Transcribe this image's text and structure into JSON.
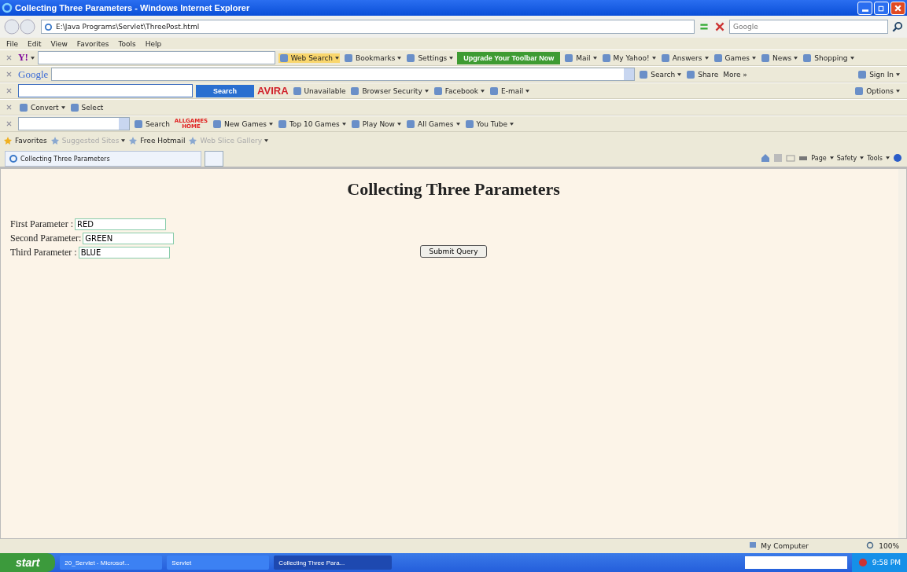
{
  "window": {
    "title": "Collecting Three Parameters - Windows Internet Explorer"
  },
  "address": {
    "value": "E:\\Java Programs\\Servlet\\ThreePost.html",
    "search_placeholder": "Google"
  },
  "menu": [
    "File",
    "Edit",
    "View",
    "Favorites",
    "Tools",
    "Help"
  ],
  "toolbars": [
    {
      "kind": "yahoo",
      "items": [
        {
          "kind": "logo",
          "label": "Y!",
          "caret": true
        },
        {
          "kind": "field",
          "caret": false
        },
        {
          "kind": "item",
          "label": "Web Search",
          "icon": true,
          "caret": true,
          "highlight": true
        },
        {
          "kind": "item",
          "label": "Bookmarks",
          "icon": true,
          "caret": true,
          "highlight": false
        },
        {
          "kind": "item",
          "label": "Settings",
          "icon": true,
          "caret": true,
          "highlight": false
        },
        {
          "kind": "green",
          "label": "Upgrade Your Toolbar Now"
        },
        {
          "kind": "item",
          "label": "Mail",
          "icon": true,
          "caret": true,
          "highlight": false
        },
        {
          "kind": "item",
          "label": "My Yahoo!",
          "icon": true,
          "caret": true,
          "highlight": false
        },
        {
          "kind": "item",
          "label": "Answers",
          "icon": true,
          "caret": true,
          "highlight": false
        },
        {
          "kind": "item",
          "label": "Games",
          "icon": true,
          "caret": true,
          "highlight": false
        },
        {
          "kind": "item",
          "label": "News",
          "icon": true,
          "caret": true,
          "highlight": false
        },
        {
          "kind": "item",
          "label": "Shopping",
          "icon": true,
          "caret": true,
          "highlight": false
        }
      ]
    },
    {
      "kind": "google",
      "items": [
        {
          "kind": "glogo",
          "label": "Google"
        },
        {
          "kind": "field",
          "caret": true
        },
        {
          "kind": "item",
          "label": "Search",
          "icon": true,
          "caret": true,
          "highlight": false
        },
        {
          "kind": "item",
          "label": "Share",
          "icon": true,
          "caret": false,
          "highlight": false
        },
        {
          "kind": "item",
          "label": "More »",
          "icon": false,
          "caret": false,
          "highlight": false
        }
      ],
      "right": [
        {
          "label": "Sign In",
          "icon": true,
          "caret": true
        }
      ]
    },
    {
      "kind": "avira",
      "items": [
        {
          "kind": "field",
          "caret": false
        },
        {
          "kind": "blue",
          "label": "Search"
        },
        {
          "kind": "alogo",
          "label": "AVIRA"
        },
        {
          "kind": "item",
          "label": "Unavailable",
          "icon": true,
          "caret": false,
          "highlight": false
        },
        {
          "kind": "item",
          "label": "Browser Security",
          "icon": true,
          "caret": true,
          "highlight": false
        },
        {
          "kind": "item",
          "label": "Facebook",
          "icon": true,
          "caret": true,
          "highlight": false
        },
        {
          "kind": "item",
          "label": "E-mail",
          "icon": true,
          "caret": true,
          "highlight": false
        }
      ],
      "right": [
        {
          "label": "Options",
          "icon": true,
          "caret": true
        }
      ]
    },
    {
      "kind": "convert",
      "items": [
        {
          "kind": "item",
          "label": "Convert",
          "icon": true,
          "caret": true,
          "highlight": false
        },
        {
          "kind": "item",
          "label": "Select",
          "icon": true,
          "caret": false,
          "highlight": false
        }
      ]
    },
    {
      "kind": "games",
      "items": [
        {
          "kind": "field",
          "caret": true
        },
        {
          "kind": "item",
          "label": "Search",
          "icon": true,
          "caret": false,
          "highlight": false
        },
        {
          "kind": "rlogo",
          "label": "ALLGAMES HOME"
        },
        {
          "kind": "item",
          "label": "New Games",
          "icon": true,
          "caret": true,
          "highlight": false
        },
        {
          "kind": "item",
          "label": "Top 10 Games",
          "icon": true,
          "caret": true,
          "highlight": false
        },
        {
          "kind": "item",
          "label": "Play Now",
          "icon": true,
          "caret": true,
          "highlight": false
        },
        {
          "kind": "item",
          "label": "All Games",
          "icon": true,
          "caret": true,
          "highlight": false
        },
        {
          "kind": "item",
          "label": "You Tube",
          "icon": true,
          "caret": true,
          "highlight": false
        }
      ]
    }
  ],
  "favorites": [
    {
      "label": "Favorites",
      "disabled": false,
      "caret": false
    },
    {
      "label": "Suggested Sites",
      "disabled": true,
      "caret": true
    },
    {
      "label": "Free Hotmail",
      "disabled": false,
      "caret": false
    },
    {
      "label": "Web Slice Gallery",
      "disabled": true,
      "caret": true
    }
  ],
  "tabs": [
    {
      "label": "Collecting Three Parameters",
      "selected": true
    }
  ],
  "commands": [
    "Page",
    "Safety",
    "Tools"
  ],
  "page": {
    "heading": "Collecting Three Parameters",
    "fields": [
      {
        "label": "First Parameter :",
        "value": "RED"
      },
      {
        "label": "Second Parameter:",
        "value": "GREEN"
      },
      {
        "label": "Third Parameter :",
        "value": "BLUE"
      }
    ],
    "submit": "Submit Query"
  },
  "status_bar": {
    "zone": "My Computer",
    "zoom": "100%"
  },
  "taskbar": {
    "start": "start",
    "tasks": [
      {
        "label": "20_Servlet - Microsof...",
        "selected": false
      },
      {
        "label": "Servlet",
        "selected": false
      },
      {
        "label": "Collecting Three Para...",
        "selected": true
      }
    ],
    "clock": "9:58 PM"
  }
}
